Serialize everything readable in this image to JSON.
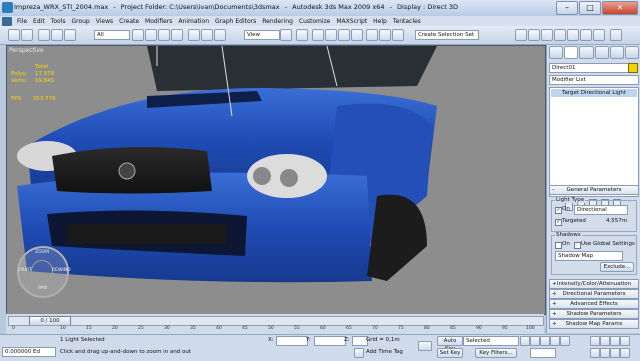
{
  "window": {
    "file": "Impreza_WRX_STI_2004.max",
    "sep1": "-",
    "project": "Project Folder: C:\\Users\\ivan\\Documents\\3dsmax",
    "sep2": "-",
    "app": "Autodesk 3ds Max  2009 x64",
    "sep3": "-",
    "display": "Display : Direct 3D"
  },
  "menu": [
    "File",
    "Edit",
    "Tools",
    "Group",
    "Views",
    "Create",
    "Modifiers",
    "Animation",
    "Graph Editors",
    "Rendering",
    "Customize",
    "MAXScript",
    "Help",
    "Tentacles"
  ],
  "toolbar": {
    "selection_filter": "All",
    "reference_coord": "View",
    "named_selection": "Create Selection Set"
  },
  "viewport": {
    "label": "Perspective",
    "stats_header": "Total",
    "stats": [
      {
        "key": "Polys:",
        "value": "17,979"
      },
      {
        "key": "Verts:",
        "value": "19,845"
      }
    ],
    "fps_label": "FPS:",
    "fps_value": "353.776",
    "nav": {
      "top": "ZOOM",
      "left": "ORBIT",
      "right": "REWIND",
      "bottom": "PAN"
    }
  },
  "command_panel": {
    "object_name": "Direct01",
    "modifier_list": "Modifier List",
    "stack_item": "Target Directional Light",
    "rollouts": {
      "general": "General Parameters",
      "light_type": "Light Type",
      "on_label": "On",
      "light_type_value": "Directional",
      "targeted": "Targeted",
      "target_distance": "4,557m",
      "shadows": "Shadows",
      "shadows_on": "On",
      "use_global": "Use Global Settings",
      "shadow_type": "Shadow Map",
      "exclude": "Exclude...",
      "collapsed": [
        "Intensity/Color/Attenuation",
        "Directional Parameters",
        "Advanced Effects",
        "Shadow Parameters",
        "Shadow Map Params"
      ]
    }
  },
  "timeline": {
    "frame_display": "0 / 100",
    "ticks": [
      "0",
      "10",
      "15",
      "20",
      "25",
      "30",
      "35",
      "40",
      "45",
      "50",
      "55",
      "60",
      "65",
      "70",
      "75",
      "80",
      "85",
      "90",
      "95",
      "100"
    ]
  },
  "status": {
    "maxscript": "0.000000 Ed",
    "selection": "1 Light Selected",
    "prompt": "Click and drag up-and-down to zoom in and out",
    "x_label": "X:",
    "y_label": "Y:",
    "z_label": "Z:",
    "grid": "Grid = 0,1m",
    "add_time_tag": "Add Time Tag",
    "auto_key": "Auto Key",
    "set_key": "Set Key",
    "key_mode": "Selected",
    "key_filters": "Key Filters..."
  }
}
